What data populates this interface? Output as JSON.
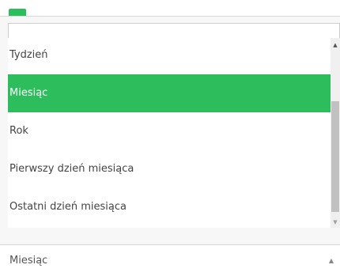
{
  "search": {
    "value": "",
    "placeholder": ""
  },
  "options": [
    {
      "label": "Tydzień",
      "selected": false
    },
    {
      "label": "Miesiąc",
      "selected": true
    },
    {
      "label": "Rok",
      "selected": false
    },
    {
      "label": "Pierwszy dzień miesiąca",
      "selected": false
    },
    {
      "label": "Ostatni dzień miesiąca",
      "selected": false
    }
  ],
  "select": {
    "value": "Miesiąc"
  },
  "icons": {
    "scroll_up": "triangle-up-icon",
    "scroll_down": "triangle-down-icon",
    "select_arrow": "triangle-up-icon"
  },
  "colors": {
    "accent": "#2ebd5c",
    "text": "#444444"
  }
}
